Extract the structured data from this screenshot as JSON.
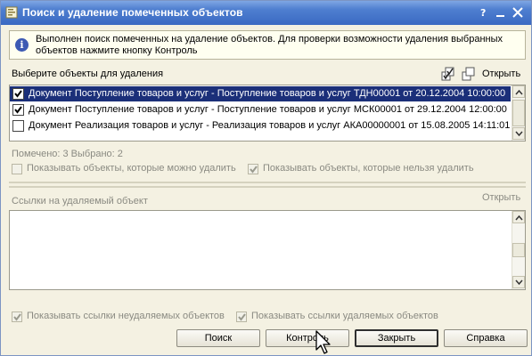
{
  "window": {
    "title": "Поиск и удаление помеченных объектов"
  },
  "info": {
    "icon": "info-icon",
    "text": "Выполнен поиск помеченных на удаление объектов. Для проверки возможности удаления выбранных объектов нажмите кнопку Контроль"
  },
  "objects_section": {
    "label": "Выберите объекты для удаления",
    "open_label": "Открыть",
    "rows": [
      {
        "checked": true,
        "selected": true,
        "text": "Документ Поступление товаров и услуг - Поступление товаров и услуг ТДН00001 от 20.12.2004 10:00:00"
      },
      {
        "checked": true,
        "selected": false,
        "text": "Документ Поступление товаров и услуг - Поступление товаров и услуг МСК00001 от 29.12.2004 12:00:00"
      },
      {
        "checked": false,
        "selected": false,
        "text": "Документ Реализация товаров и услуг - Реализация товаров и услуг АКА00000001 от 15.08.2005 14:11:01"
      }
    ]
  },
  "status": {
    "text": "Помечено: 3 Выбрано: 2"
  },
  "filters": {
    "show_deletable": {
      "label": "Показывать объекты, которые можно удалить",
      "checked": false
    },
    "show_undeletable": {
      "label": "Показывать объекты, которые нельзя удалить",
      "checked": true
    }
  },
  "refs_section": {
    "label": "Ссылки на удаляемый объект",
    "open_label": "Открыть"
  },
  "refs_filters": {
    "show_nondeleted": {
      "label": "Показывать ссылки неудаляемых объектов",
      "checked": true
    },
    "show_deleted": {
      "label": "Показывать ссылки удаляемых объектов",
      "checked": true
    }
  },
  "buttons": {
    "search": "Поиск",
    "control": "Контроль",
    "close": "Закрыть",
    "help": "Справка"
  },
  "colors": {
    "selection": "#1b2f79",
    "titlebar": "#4f7fd0",
    "background": "#f4f1e2"
  }
}
